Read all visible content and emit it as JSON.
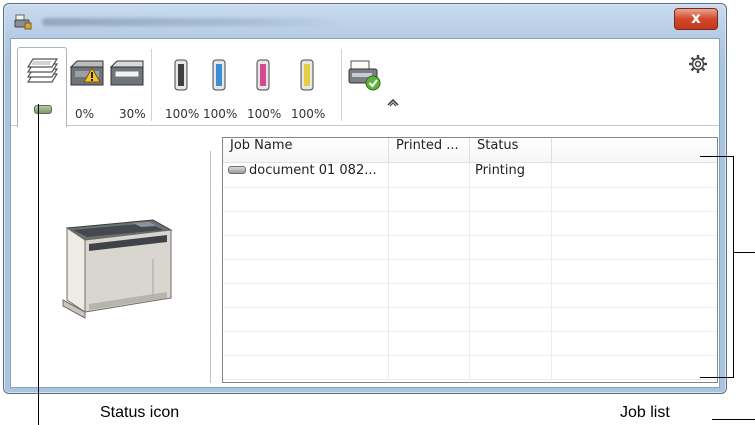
{
  "window": {
    "close_glyph": "x",
    "title_icon": "printer-app-icon",
    "settings_icon": "gear-icon"
  },
  "toolbar": {
    "status_tab_icon": "printer-status-icon",
    "supplies": [
      {
        "name": "paper-tray-1",
        "icon": "paper-tray-icon",
        "label": "0%",
        "warning": true
      },
      {
        "name": "paper-tray-2",
        "icon": "paper-tray-icon",
        "label": "30%"
      },
      {
        "name": "toner-black",
        "icon": "toner-cartridge-icon",
        "label": "100%",
        "color": "#404040"
      },
      {
        "name": "toner-cyan",
        "icon": "toner-cartridge-icon",
        "label": "100%",
        "color": "#3a8fd6"
      },
      {
        "name": "toner-magenta",
        "icon": "toner-cartridge-icon",
        "label": "100%",
        "color": "#d64a8f"
      },
      {
        "name": "toner-yellow",
        "icon": "toner-cartridge-icon",
        "label": "100%",
        "color": "#e2cf44"
      }
    ],
    "device_status_icon": "device-ok-icon",
    "collapse_icon": "caret-up-icon"
  },
  "job_list": {
    "columns": [
      "Job Name",
      "Printed ...",
      "Status"
    ],
    "rows": [
      {
        "job_name": "document 01 082...",
        "printed": "",
        "status": "Printing"
      }
    ]
  },
  "callouts": {
    "status_icon": "Status icon",
    "job_list": "Job list"
  }
}
